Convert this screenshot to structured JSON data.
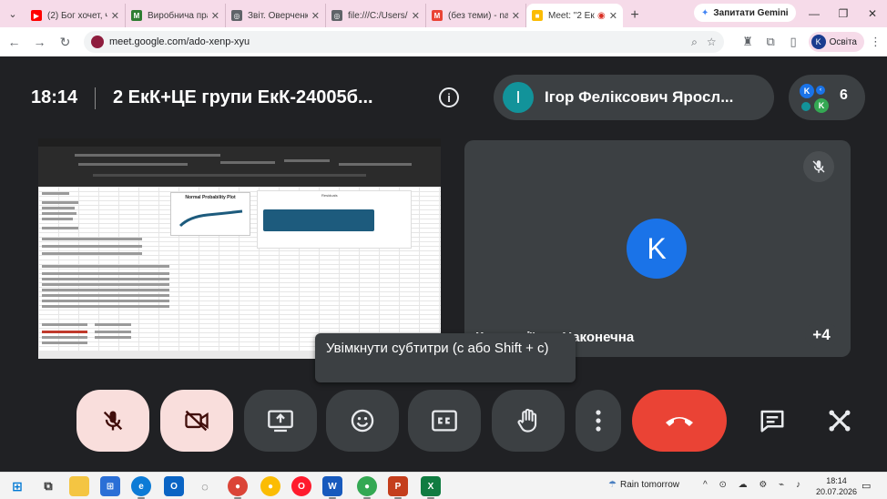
{
  "browser": {
    "tabs": [
      {
        "title": "(2) Бог хочет, чт",
        "favicon_color": "#ff0000",
        "favicon": "▶"
      },
      {
        "title": "Виробнича пра",
        "favicon_color": "#2e7d32",
        "favicon": "M"
      },
      {
        "title": "Звіт. Оверченк",
        "favicon_color": "#5f6368",
        "favicon": "◎"
      },
      {
        "title": "file:///C:/Users/",
        "favicon_color": "#5f6368",
        "favicon": "◎"
      },
      {
        "title": "(без теми) - nai",
        "favicon_color": "#ea4335",
        "favicon": "M"
      },
      {
        "title": "Meet: \"2 Ек",
        "favicon_color": "#fbbc04",
        "favicon": "■"
      }
    ],
    "gemini_label": "Запитати Gemini",
    "url": "meet.google.com/ado-xenp-xyu",
    "profile": {
      "initial": "K",
      "label": "Освіта"
    }
  },
  "meet": {
    "time": "18:14",
    "title": "2 ЕкК+ЦЕ групи ЕкК-24005б...",
    "presenter": {
      "initial": "І",
      "name": "Ігор Феліксович Яросл..."
    },
    "participants_count": "6",
    "people_avatars": [
      {
        "initial": "K",
        "color": "#1a73e8"
      },
      {
        "initial": "K",
        "color": "#34a853"
      }
    ],
    "shared_screen": {
      "normal_plot_title": "Normal Probability Plot",
      "residual_title": "Residuals"
    },
    "tile": {
      "initial": "K",
      "name": "К... ...аліївна Наконечна",
      "more_count": "+4"
    },
    "tooltip": "Увімкнути субтитри (с або Shift + c)",
    "colors": {
      "end_call": "#ea4335",
      "muted_bg": "#f9dedc",
      "button_bg": "#3c4043",
      "accent_blue": "#1a73e8"
    }
  },
  "taskbar": {
    "weather": "Rain tomorrow",
    "time": "18:14",
    "date": "20.07.2026"
  }
}
